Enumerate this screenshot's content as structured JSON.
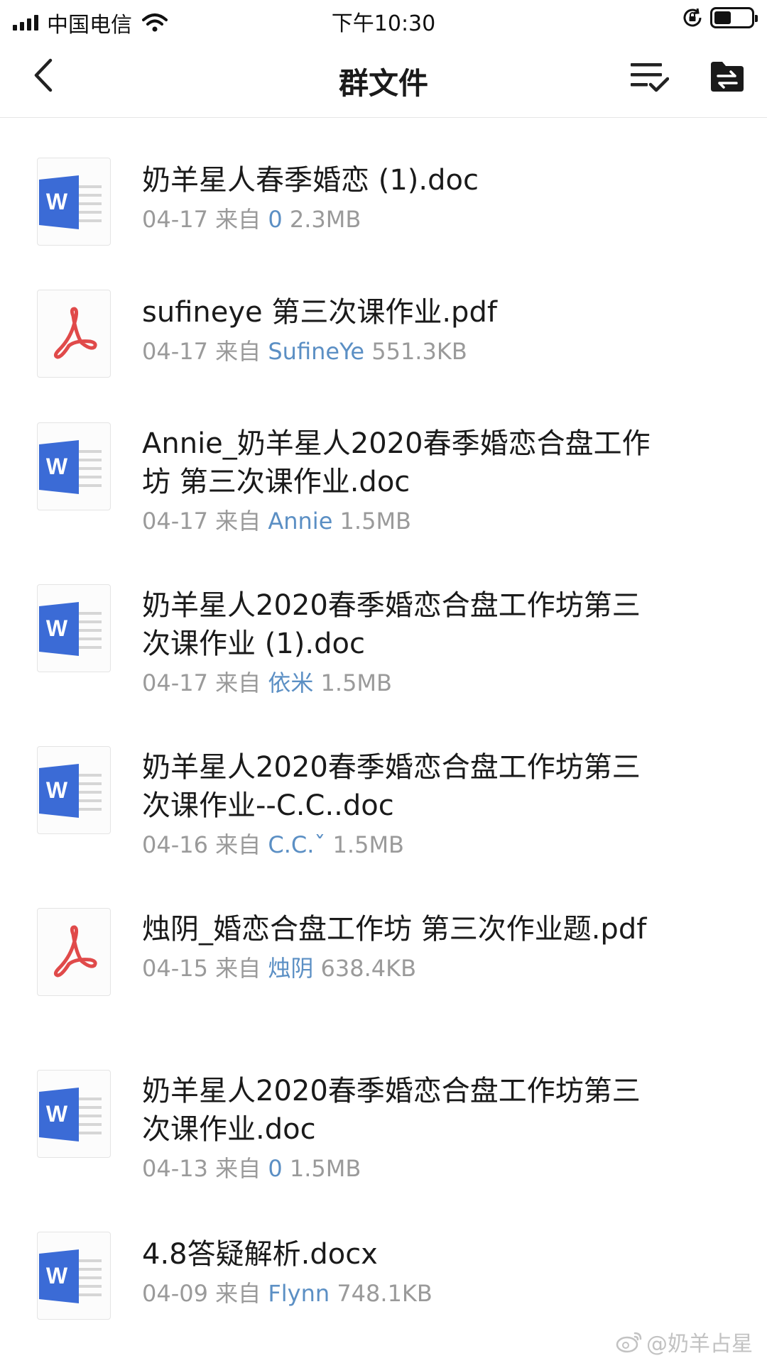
{
  "status_bar": {
    "carrier": "中国电信",
    "time": "下午10:30",
    "battery_level": 0.45
  },
  "nav": {
    "title": "群文件"
  },
  "files": [
    {
      "type": "word",
      "name": "奶羊星人春季婚恋 (1).doc",
      "date": "04-17",
      "from_label": "来自",
      "sender": "0",
      "size": "2.3MB"
    },
    {
      "type": "pdf",
      "name": "sufineye 第三次课作业.pdf",
      "date": "04-17",
      "from_label": "来自",
      "sender": "SufineYe",
      "size": "551.3KB"
    },
    {
      "type": "word",
      "name": "Annie_奶羊星人2020春季婚恋合盘工作坊 第三次课作业.doc",
      "date": "04-17",
      "from_label": "来自",
      "sender": "Annie",
      "size": "1.5MB"
    },
    {
      "type": "word",
      "name": "奶羊星人2020春季婚恋合盘工作坊第三次课作业 (1).doc",
      "date": "04-17",
      "from_label": "来自",
      "sender": "依米",
      "size": "1.5MB"
    },
    {
      "type": "word",
      "name": "奶羊星人2020春季婚恋合盘工作坊第三次课作业--C.C..doc",
      "date": "04-16",
      "from_label": "来自",
      "sender": "C.C.ˇ",
      "size": "1.5MB"
    },
    {
      "type": "pdf",
      "name": "烛阴_婚恋合盘工作坊 第三次作业题.pdf",
      "date": "04-15",
      "from_label": "来自",
      "sender": "烛阴",
      "size": "638.4KB"
    },
    {
      "type": "word",
      "name": "奶羊星人2020春季婚恋合盘工作坊第三次课作业.doc",
      "date": "04-13",
      "from_label": "来自",
      "sender": "0",
      "size": "1.5MB"
    },
    {
      "type": "word",
      "name": "4.8答疑解析.docx",
      "date": "04-09",
      "from_label": "来自",
      "sender": "Flynn",
      "size": "748.1KB"
    }
  ],
  "watermark": "@奶羊占星",
  "colors": {
    "sender_link": "#5b8fc4",
    "word_blue": "#3b6bd6",
    "pdf_red": "#e04a4a"
  }
}
